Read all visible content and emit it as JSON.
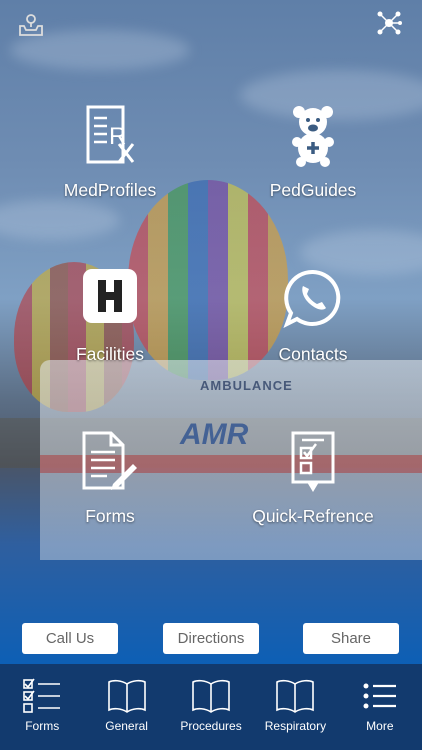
{
  "tiles": [
    {
      "label": "MedProfiles",
      "icon": "prescription-icon"
    },
    {
      "label": "PedGuides",
      "icon": "teddy-bear-icon"
    },
    {
      "label": "Facilities",
      "icon": "hospital-h-icon"
    },
    {
      "label": "Contacts",
      "icon": "whatsapp-phone-icon"
    },
    {
      "label": "Forms",
      "icon": "document-pencil-icon"
    },
    {
      "label": "Quick-Refrence",
      "icon": "checklist-document-icon"
    }
  ],
  "background": {
    "vehicle_label": "AMBULANCE",
    "vehicle_brand": "AMR"
  },
  "actions": {
    "call": "Call Us",
    "directions": "Directions",
    "share": "Share"
  },
  "tabbar": [
    {
      "label": "Forms",
      "icon": "checklist-icon"
    },
    {
      "label": "General",
      "icon": "book-icon"
    },
    {
      "label": "Procedures",
      "icon": "book-icon"
    },
    {
      "label": "Respiratory",
      "icon": "book-icon"
    },
    {
      "label": "More",
      "icon": "list-icon"
    }
  ],
  "colors": {
    "tabbar": "#123a6e",
    "button_bg": "#ffffff",
    "button_text": "#666666",
    "label": "#ffffff"
  }
}
